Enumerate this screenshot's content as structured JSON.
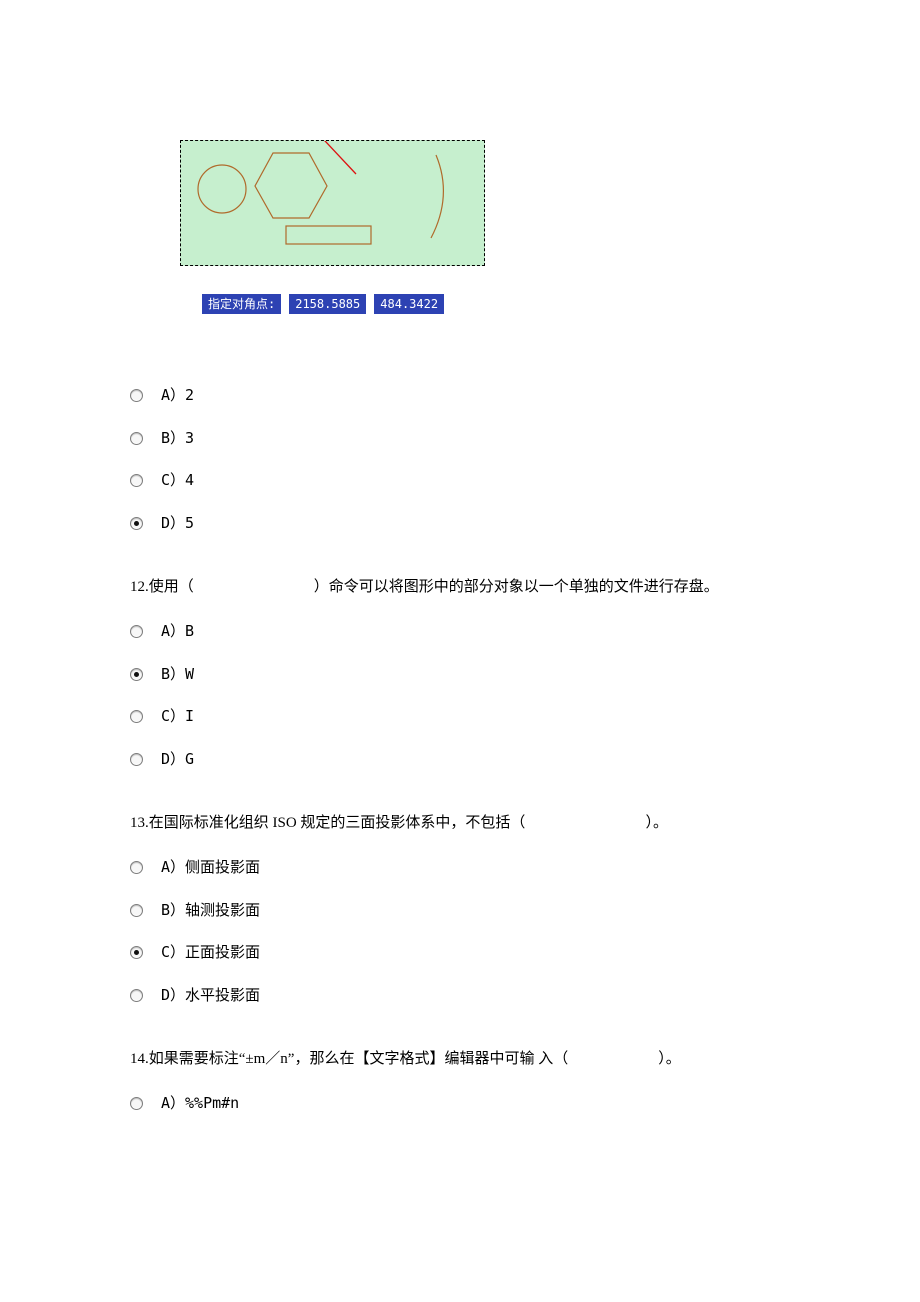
{
  "figure": {
    "cmd_label": "指定对角点:",
    "coord_x": "2158.5885",
    "coord_y": "484.3422"
  },
  "q11": {
    "options": {
      "a": "A）2",
      "b": "B）3",
      "c": "C）4",
      "d": "D）5"
    },
    "selected": "d"
  },
  "q12": {
    "prefix": "12.使用（",
    "suffix": "）命令可以将图形中的部分对象以一个单独的文件进行存盘。",
    "options": {
      "a": "A）B",
      "b": "B）W",
      "c": "C）I",
      "d": "D）G"
    },
    "selected": "b"
  },
  "q13": {
    "prefix": "13.在国际标准化组织 ISO 规定的三面投影体系中，不包括（",
    "suffix": "）。",
    "options": {
      "a": "A）侧面投影面",
      "b": "B）轴测投影面",
      "c": "C）正面投影面",
      "d": "D）水平投影面"
    },
    "selected": "c"
  },
  "q14": {
    "prefix": "14.如果需要标注“±m／n”，那么在【文字格式】编辑器中可输 入（",
    "suffix": "）。",
    "options": {
      "a": "A）%%Pm#n"
    }
  }
}
